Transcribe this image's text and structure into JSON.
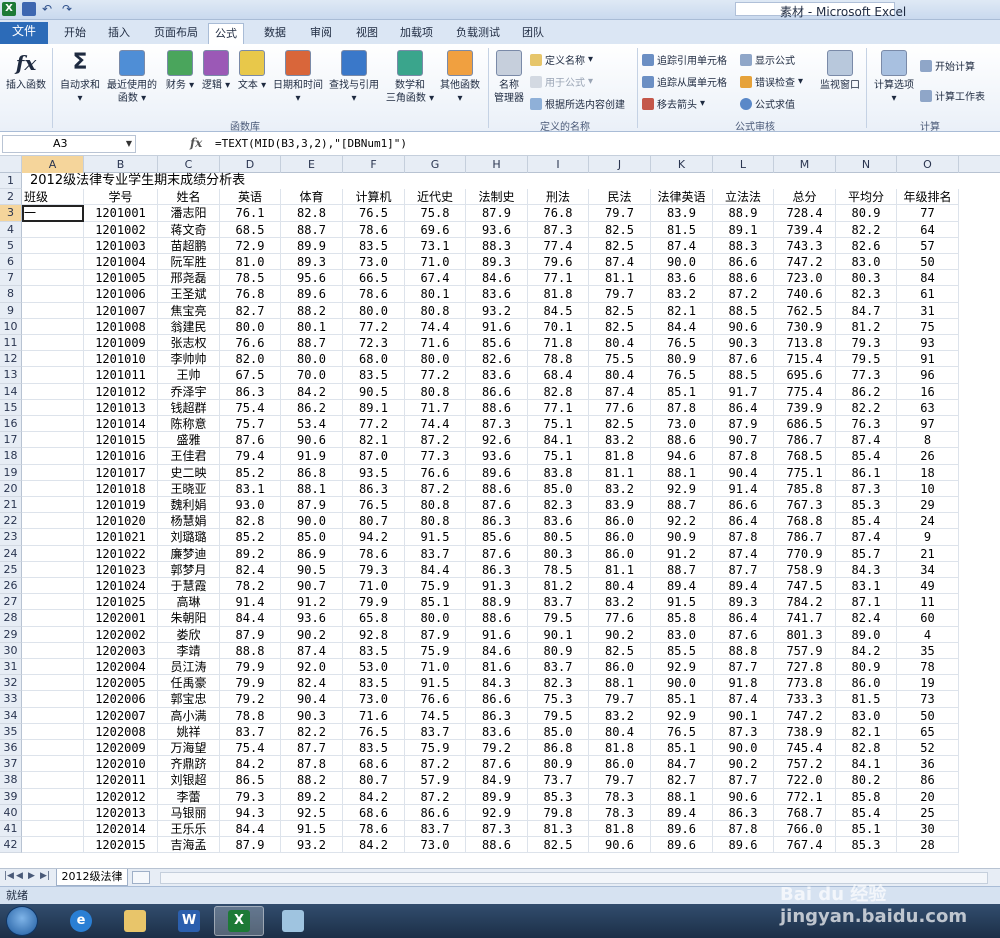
{
  "window": {
    "title": "素材 - Microsoft Excel"
  },
  "tabs": [
    "文件",
    "开始",
    "插入",
    "页面布局",
    "公式",
    "数据",
    "审阅",
    "视图",
    "加载项",
    "负载测试",
    "团队"
  ],
  "ribbon": {
    "insert_function": "插入函数",
    "autosum": "自动求和",
    "recent": "最近使用的",
    "recent2": "函数",
    "financial": "财务",
    "logical": "逻辑",
    "text": "文本",
    "datetime": "日期和时间",
    "lookup": "查找与引用",
    "math": "数学和",
    "math2": "三角函数",
    "other": "其他函数",
    "name_mgr": "名称",
    "name_mgr2": "管理器",
    "define_name": "定义名称",
    "use_in_formula": "用于公式",
    "create_from_sel": "根据所选内容创建",
    "trace_precedents": "追踪引用单元格",
    "trace_dependents": "追踪从属单元格",
    "remove_arrows": "移去箭头",
    "show_formulas": "显示公式",
    "error_check": "错误检查",
    "eval_formula": "公式求值",
    "watch_window": "监视窗口",
    "calc_options": "计算选项",
    "calc_now": "开始计算",
    "calc_sheet": "计算工作表",
    "group_function_library": "函数库",
    "group_defined_names": "定义的名称",
    "group_formula_auditing": "公式审核",
    "group_calculation": "计算"
  },
  "formula_bar": {
    "name_box": "A3",
    "fx": "fx",
    "formula": "=TEXT(MID(B3,3,2),\"[DBNum1]\")"
  },
  "columns": [
    "A",
    "B",
    "C",
    "D",
    "E",
    "F",
    "G",
    "H",
    "I",
    "J",
    "K",
    "L",
    "M",
    "N",
    "O"
  ],
  "sheet": {
    "title": "2012级法律专业学生期末成绩分析表",
    "headers": [
      "班级",
      "学号",
      "姓名",
      "英语",
      "体育",
      "计算机",
      "近代史",
      "法制史",
      "刑法",
      "民法",
      "法律英语",
      "立法法",
      "总分",
      "平均分",
      "年级排名"
    ],
    "rows": [
      [
        "一",
        "1201001",
        "潘志阳",
        "76.1",
        "82.8",
        "76.5",
        "75.8",
        "87.9",
        "76.8",
        "79.7",
        "83.9",
        "88.9",
        "728.4",
        "80.9",
        "77"
      ],
      [
        "",
        "1201002",
        "蒋文奇",
        "68.5",
        "88.7",
        "78.6",
        "69.6",
        "93.6",
        "87.3",
        "82.5",
        "81.5",
        "89.1",
        "739.4",
        "82.2",
        "64"
      ],
      [
        "",
        "1201003",
        "苗超鹏",
        "72.9",
        "89.9",
        "83.5",
        "73.1",
        "88.3",
        "77.4",
        "82.5",
        "87.4",
        "88.3",
        "743.3",
        "82.6",
        "57"
      ],
      [
        "",
        "1201004",
        "阮军胜",
        "81.0",
        "89.3",
        "73.0",
        "71.0",
        "89.3",
        "79.6",
        "87.4",
        "90.0",
        "86.6",
        "747.2",
        "83.0",
        "50"
      ],
      [
        "",
        "1201005",
        "邢尧磊",
        "78.5",
        "95.6",
        "66.5",
        "67.4",
        "84.6",
        "77.1",
        "81.1",
        "83.6",
        "88.6",
        "723.0",
        "80.3",
        "84"
      ],
      [
        "",
        "1201006",
        "王圣斌",
        "76.8",
        "89.6",
        "78.6",
        "80.1",
        "83.6",
        "81.8",
        "79.7",
        "83.2",
        "87.2",
        "740.6",
        "82.3",
        "61"
      ],
      [
        "",
        "1201007",
        "焦宝亮",
        "82.7",
        "88.2",
        "80.0",
        "80.8",
        "93.2",
        "84.5",
        "82.5",
        "82.1",
        "88.5",
        "762.5",
        "84.7",
        "31"
      ],
      [
        "",
        "1201008",
        "翁建民",
        "80.0",
        "80.1",
        "77.2",
        "74.4",
        "91.6",
        "70.1",
        "82.5",
        "84.4",
        "90.6",
        "730.9",
        "81.2",
        "75"
      ],
      [
        "",
        "1201009",
        "张志权",
        "76.6",
        "88.7",
        "72.3",
        "71.6",
        "85.6",
        "71.8",
        "80.4",
        "76.5",
        "90.3",
        "713.8",
        "79.3",
        "93"
      ],
      [
        "",
        "1201010",
        "李帅帅",
        "82.0",
        "80.0",
        "68.0",
        "80.0",
        "82.6",
        "78.8",
        "75.5",
        "80.9",
        "87.6",
        "715.4",
        "79.5",
        "91"
      ],
      [
        "",
        "1201011",
        "王帅",
        "67.5",
        "70.0",
        "83.5",
        "77.2",
        "83.6",
        "68.4",
        "80.4",
        "76.5",
        "88.5",
        "695.6",
        "77.3",
        "96"
      ],
      [
        "",
        "1201012",
        "乔泽宇",
        "86.3",
        "84.2",
        "90.5",
        "80.8",
        "86.6",
        "82.8",
        "87.4",
        "85.1",
        "91.7",
        "775.4",
        "86.2",
        "16"
      ],
      [
        "",
        "1201013",
        "钱超群",
        "75.4",
        "86.2",
        "89.1",
        "71.7",
        "88.6",
        "77.1",
        "77.6",
        "87.8",
        "86.4",
        "739.9",
        "82.2",
        "63"
      ],
      [
        "",
        "1201014",
        "陈称意",
        "75.7",
        "53.4",
        "77.2",
        "74.4",
        "87.3",
        "75.1",
        "82.5",
        "73.0",
        "87.9",
        "686.5",
        "76.3",
        "97"
      ],
      [
        "",
        "1201015",
        "盛雅",
        "87.6",
        "90.6",
        "82.1",
        "87.2",
        "92.6",
        "84.1",
        "83.2",
        "88.6",
        "90.7",
        "786.7",
        "87.4",
        "8"
      ],
      [
        "",
        "1201016",
        "王佳君",
        "79.4",
        "91.9",
        "87.0",
        "77.3",
        "93.6",
        "75.1",
        "81.8",
        "94.6",
        "87.8",
        "768.5",
        "85.4",
        "26"
      ],
      [
        "",
        "1201017",
        "史二映",
        "85.2",
        "86.8",
        "93.5",
        "76.6",
        "89.6",
        "83.8",
        "81.1",
        "88.1",
        "90.4",
        "775.1",
        "86.1",
        "18"
      ],
      [
        "",
        "1201018",
        "王晓亚",
        "83.1",
        "88.1",
        "86.3",
        "87.2",
        "88.6",
        "85.0",
        "83.2",
        "92.9",
        "91.4",
        "785.8",
        "87.3",
        "10"
      ],
      [
        "",
        "1201019",
        "魏利娟",
        "93.0",
        "87.9",
        "76.5",
        "80.8",
        "87.6",
        "82.3",
        "83.9",
        "88.7",
        "86.6",
        "767.3",
        "85.3",
        "29"
      ],
      [
        "",
        "1201020",
        "杨慧娟",
        "82.8",
        "90.0",
        "80.7",
        "80.8",
        "86.3",
        "83.6",
        "86.0",
        "92.2",
        "86.4",
        "768.8",
        "85.4",
        "24"
      ],
      [
        "",
        "1201021",
        "刘璐璐",
        "85.2",
        "85.0",
        "94.2",
        "91.5",
        "85.6",
        "80.5",
        "86.0",
        "90.9",
        "87.8",
        "786.7",
        "87.4",
        "9"
      ],
      [
        "",
        "1201022",
        "廉梦迪",
        "89.2",
        "86.9",
        "78.6",
        "83.7",
        "87.6",
        "80.3",
        "86.0",
        "91.2",
        "87.4",
        "770.9",
        "85.7",
        "21"
      ],
      [
        "",
        "1201023",
        "郭梦月",
        "82.4",
        "90.5",
        "79.3",
        "84.4",
        "86.3",
        "78.5",
        "81.1",
        "88.7",
        "87.7",
        "758.9",
        "84.3",
        "34"
      ],
      [
        "",
        "1201024",
        "于慧霞",
        "78.2",
        "90.7",
        "71.0",
        "75.9",
        "91.3",
        "81.2",
        "80.4",
        "89.4",
        "89.4",
        "747.5",
        "83.1",
        "49"
      ],
      [
        "",
        "1201025",
        "高琳",
        "91.4",
        "91.2",
        "79.9",
        "85.1",
        "88.9",
        "83.7",
        "83.2",
        "91.5",
        "89.3",
        "784.2",
        "87.1",
        "11"
      ],
      [
        "",
        "1202001",
        "朱朝阳",
        "84.4",
        "93.6",
        "65.8",
        "80.0",
        "88.6",
        "79.5",
        "77.6",
        "85.8",
        "86.4",
        "741.7",
        "82.4",
        "60"
      ],
      [
        "",
        "1202002",
        "娄欣",
        "87.9",
        "90.2",
        "92.8",
        "87.9",
        "91.6",
        "90.1",
        "90.2",
        "83.0",
        "87.6",
        "801.3",
        "89.0",
        "4"
      ],
      [
        "",
        "1202003",
        "李靖",
        "88.8",
        "87.4",
        "83.5",
        "75.9",
        "84.6",
        "80.9",
        "82.5",
        "85.5",
        "88.8",
        "757.9",
        "84.2",
        "35"
      ],
      [
        "",
        "1202004",
        "员江涛",
        "79.9",
        "92.0",
        "53.0",
        "71.0",
        "81.6",
        "83.7",
        "86.0",
        "92.9",
        "87.7",
        "727.8",
        "80.9",
        "78"
      ],
      [
        "",
        "1202005",
        "任禹豪",
        "79.9",
        "82.4",
        "83.5",
        "91.5",
        "84.3",
        "82.3",
        "88.1",
        "90.0",
        "91.8",
        "773.8",
        "86.0",
        "19"
      ],
      [
        "",
        "1202006",
        "郭宝忠",
        "79.2",
        "90.4",
        "73.0",
        "76.6",
        "86.6",
        "75.3",
        "79.7",
        "85.1",
        "87.4",
        "733.3",
        "81.5",
        "73"
      ],
      [
        "",
        "1202007",
        "高小满",
        "78.8",
        "90.3",
        "71.6",
        "74.5",
        "86.3",
        "79.5",
        "83.2",
        "92.9",
        "90.1",
        "747.2",
        "83.0",
        "50"
      ],
      [
        "",
        "1202008",
        "姚祥",
        "83.7",
        "82.2",
        "76.5",
        "83.7",
        "83.6",
        "85.0",
        "80.4",
        "76.5",
        "87.3",
        "738.9",
        "82.1",
        "65"
      ],
      [
        "",
        "1202009",
        "万海望",
        "75.4",
        "87.7",
        "83.5",
        "75.9",
        "79.2",
        "86.8",
        "81.8",
        "85.1",
        "90.0",
        "745.4",
        "82.8",
        "52"
      ],
      [
        "",
        "1202010",
        "齐鼎跻",
        "84.2",
        "87.8",
        "68.6",
        "87.2",
        "87.6",
        "80.9",
        "86.0",
        "84.7",
        "90.2",
        "757.2",
        "84.1",
        "36"
      ],
      [
        "",
        "1202011",
        "刘银超",
        "86.5",
        "88.2",
        "80.7",
        "57.9",
        "84.9",
        "73.7",
        "79.7",
        "82.7",
        "87.7",
        "722.0",
        "80.2",
        "86"
      ],
      [
        "",
        "1202012",
        "李蕾",
        "79.3",
        "89.2",
        "84.2",
        "87.2",
        "89.9",
        "85.3",
        "78.3",
        "88.1",
        "90.6",
        "772.1",
        "85.8",
        "20"
      ],
      [
        "",
        "1202013",
        "马银丽",
        "94.3",
        "92.5",
        "68.6",
        "86.6",
        "92.9",
        "79.8",
        "78.3",
        "89.4",
        "86.3",
        "768.7",
        "85.4",
        "25"
      ],
      [
        "",
        "1202014",
        "王乐乐",
        "84.4",
        "91.5",
        "78.6",
        "83.7",
        "87.3",
        "81.3",
        "81.8",
        "89.6",
        "87.8",
        "766.0",
        "85.1",
        "30"
      ],
      [
        "",
        "1202015",
        "吉海孟",
        "87.9",
        "93.2",
        "84.2",
        "73.0",
        "88.6",
        "82.5",
        "90.6",
        "89.6",
        "89.6",
        "767.4",
        "85.3",
        "28"
      ]
    ]
  },
  "sheet_tab": "2012级法律",
  "status": "就绪",
  "watermark": "Bai du 经验 jingyan.baidu.com"
}
